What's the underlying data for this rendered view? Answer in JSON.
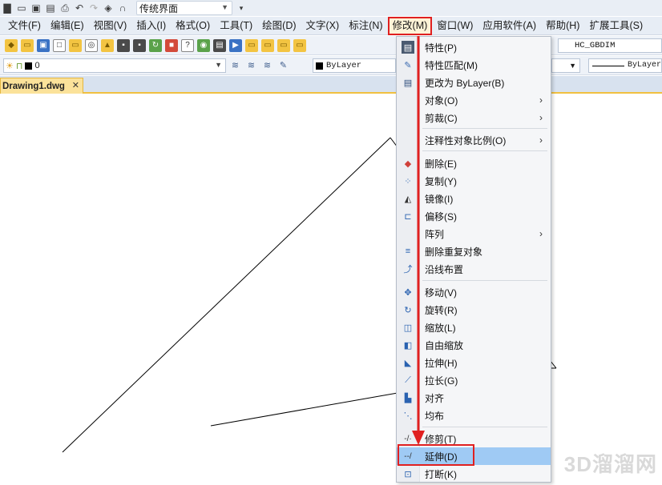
{
  "qat": {
    "workspace": "传统界面"
  },
  "menubar": [
    "文件(F)",
    "编辑(E)",
    "视图(V)",
    "插入(I)",
    "格式(O)",
    "工具(T)",
    "绘图(D)",
    "文字(X)",
    "标注(N)",
    "修改(M)",
    "窗口(W)",
    "应用软件(A)",
    "帮助(H)",
    "扩展工具(S)"
  ],
  "active_menu": "修改(M)",
  "toolbar": {
    "dimstyle": "HC_GBDIM",
    "layer_name": "0",
    "color": "ByLayer",
    "linetype": "ByLayer"
  },
  "tab": {
    "name": "Drawing1.dwg",
    "close": "✕"
  },
  "watermark": "3D溜溜网",
  "modify_menu": [
    {
      "label": "特性(P)",
      "icon": "properties-icon",
      "sub": false
    },
    {
      "label": "特性匹配(M)",
      "icon": "match-properties-icon",
      "sub": false
    },
    {
      "label": "更改为 ByLayer(B)",
      "icon": "bylayer-icon",
      "sub": false
    },
    {
      "label": "对象(O)",
      "icon": "",
      "sub": true
    },
    {
      "label": "剪裁(C)",
      "icon": "",
      "sub": true
    },
    {
      "label": "注释性对象比例(O)",
      "icon": "",
      "sub": true
    },
    {
      "label": "删除(E)",
      "icon": "eraser-icon",
      "sub": false
    },
    {
      "label": "复制(Y)",
      "icon": "copy-icon",
      "sub": false
    },
    {
      "label": "镜像(I)",
      "icon": "mirror-icon",
      "sub": false
    },
    {
      "label": "偏移(S)",
      "icon": "offset-icon",
      "sub": false
    },
    {
      "label": "阵列",
      "icon": "",
      "sub": true
    },
    {
      "label": "删除重复对象",
      "icon": "delete-duplicates-icon",
      "sub": false
    },
    {
      "label": "沿线布置",
      "icon": "along-line-icon",
      "sub": false
    },
    {
      "label": "移动(V)",
      "icon": "move-icon",
      "sub": false
    },
    {
      "label": "旋转(R)",
      "icon": "rotate-icon",
      "sub": false
    },
    {
      "label": "缩放(L)",
      "icon": "scale-icon",
      "sub": false
    },
    {
      "label": "自由缩放",
      "icon": "free-scale-icon",
      "sub": false
    },
    {
      "label": "拉伸(H)",
      "icon": "stretch-icon",
      "sub": false
    },
    {
      "label": "拉长(G)",
      "icon": "lengthen-icon",
      "sub": false
    },
    {
      "label": "对齐",
      "icon": "align-icon",
      "sub": false
    },
    {
      "label": "均布",
      "icon": "distribute-icon",
      "sub": false
    },
    {
      "label": "修剪(T)",
      "icon": "trim-icon",
      "sub": false
    },
    {
      "label": "延伸(D)",
      "icon": "extend-icon",
      "sub": false,
      "highlighted": true
    },
    {
      "label": "打断(K)",
      "icon": "break-icon",
      "sub": false
    }
  ]
}
